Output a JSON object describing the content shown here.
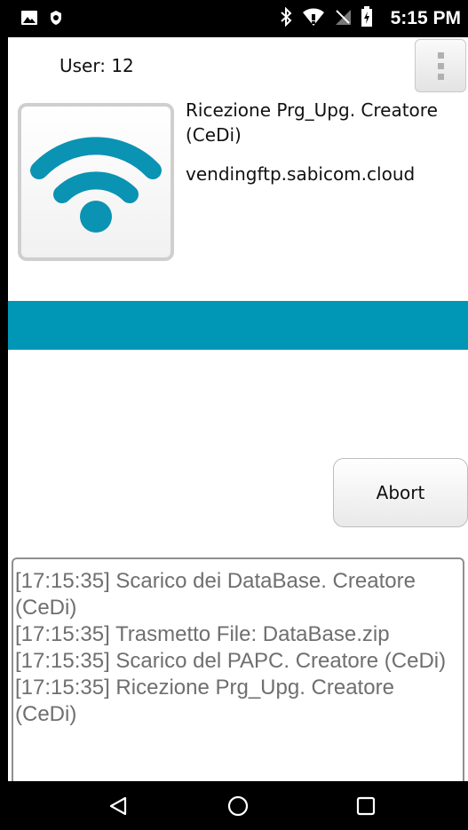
{
  "status_bar": {
    "time": "5:15 PM",
    "left_icons": [
      "image-notification-icon",
      "vpn-shield-icon"
    ],
    "right_icons": [
      "bluetooth-icon",
      "wifi-signal-icon",
      "cellular-no-signal-icon",
      "battery-charging-icon"
    ]
  },
  "header": {
    "user_label": "User: 12",
    "menu_icon": "overflow-menu-icon"
  },
  "task": {
    "icon": "wifi-icon",
    "title": "Ricezione Prg_Upg. Creatore (CeDi)",
    "host": "vendingftp.sabicom.cloud"
  },
  "progress": {
    "fraction": 1.0,
    "color": "#0097b6"
  },
  "actions": {
    "abort_label": "Abort"
  },
  "log": {
    "lines": [
      "[17:15:35] Scarico dei DataBase. Creatore (CeDi)",
      "[17:15:35] Trasmetto File: DataBase.zip",
      "[17:15:35] Scarico del PAPC. Creatore (CeDi)",
      "[17:15:35] Ricezione Prg_Upg. Creatore (CeDi)"
    ]
  },
  "nav_bar": {
    "buttons": [
      "back-icon",
      "home-icon",
      "recents-icon"
    ]
  },
  "colors": {
    "accent": "#0097b6",
    "log_text": "#6f6f6f"
  }
}
